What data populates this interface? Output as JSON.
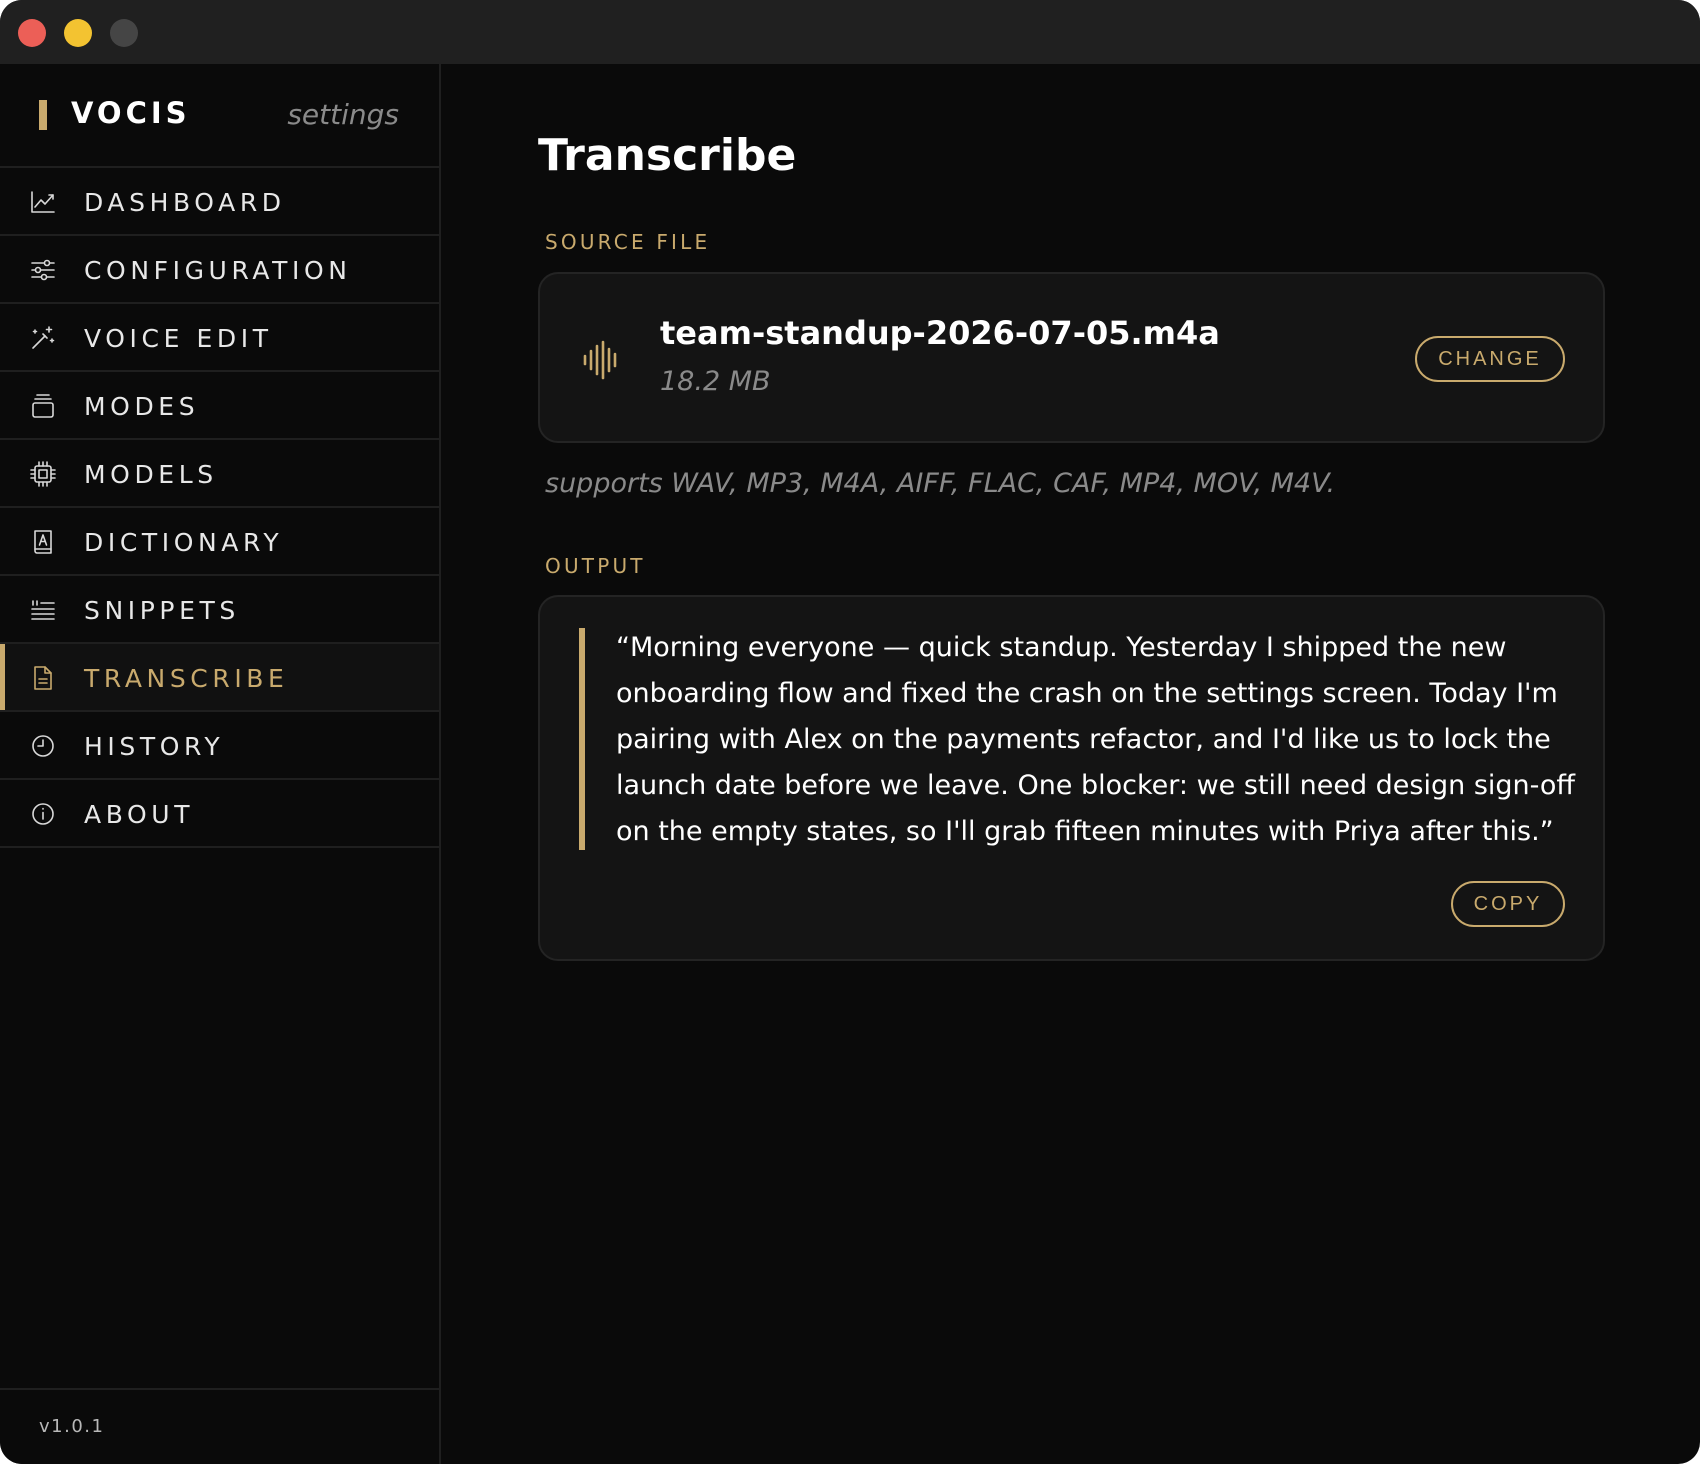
{
  "app": {
    "name": "VOCIS",
    "subtitle": "settings",
    "version": "v1.0.1",
    "accent_color": "#c9aa6d"
  },
  "sidebar": {
    "items": [
      {
        "label": "DASHBOARD",
        "icon": "chart-line-icon",
        "active": false
      },
      {
        "label": "CONFIGURATION",
        "icon": "sliders-icon",
        "active": false
      },
      {
        "label": "VOICE EDIT",
        "icon": "magic-wand-icon",
        "active": false
      },
      {
        "label": "MODES",
        "icon": "layers-icon",
        "active": false
      },
      {
        "label": "MODELS",
        "icon": "chip-icon",
        "active": false
      },
      {
        "label": "DICTIONARY",
        "icon": "dictionary-book-icon",
        "active": false
      },
      {
        "label": "SNIPPETS",
        "icon": "quote-lines-icon",
        "active": false
      },
      {
        "label": "TRANSCRIBE",
        "icon": "document-icon",
        "active": true
      },
      {
        "label": "HISTORY",
        "icon": "clock-icon",
        "active": false
      },
      {
        "label": "ABOUT",
        "icon": "info-icon",
        "active": false
      }
    ]
  },
  "main": {
    "title": "Transcribe",
    "source": {
      "section_label": "SOURCE FILE",
      "file_name": "team-standup-2026-07-05.m4a",
      "file_size": "18.2 MB",
      "change_label": "CHANGE",
      "icon": "audio-waveform-icon",
      "supports_text": "supports WAV, MP3, M4A, AIFF, FLAC, CAF, MP4, MOV, M4V."
    },
    "output": {
      "section_label": "OUTPUT",
      "text": "“Morning everyone — quick standup. Yesterday I shipped the new onboarding flow and fixed the crash on the settings screen. Today I'm pairing with Alex on the payments refactor, and I'd like us to lock the launch date before we leave. One blocker: we still need design sign-off on the empty states, so I'll grab fifteen minutes with Priya after this.”",
      "copy_label": "COPY"
    }
  }
}
